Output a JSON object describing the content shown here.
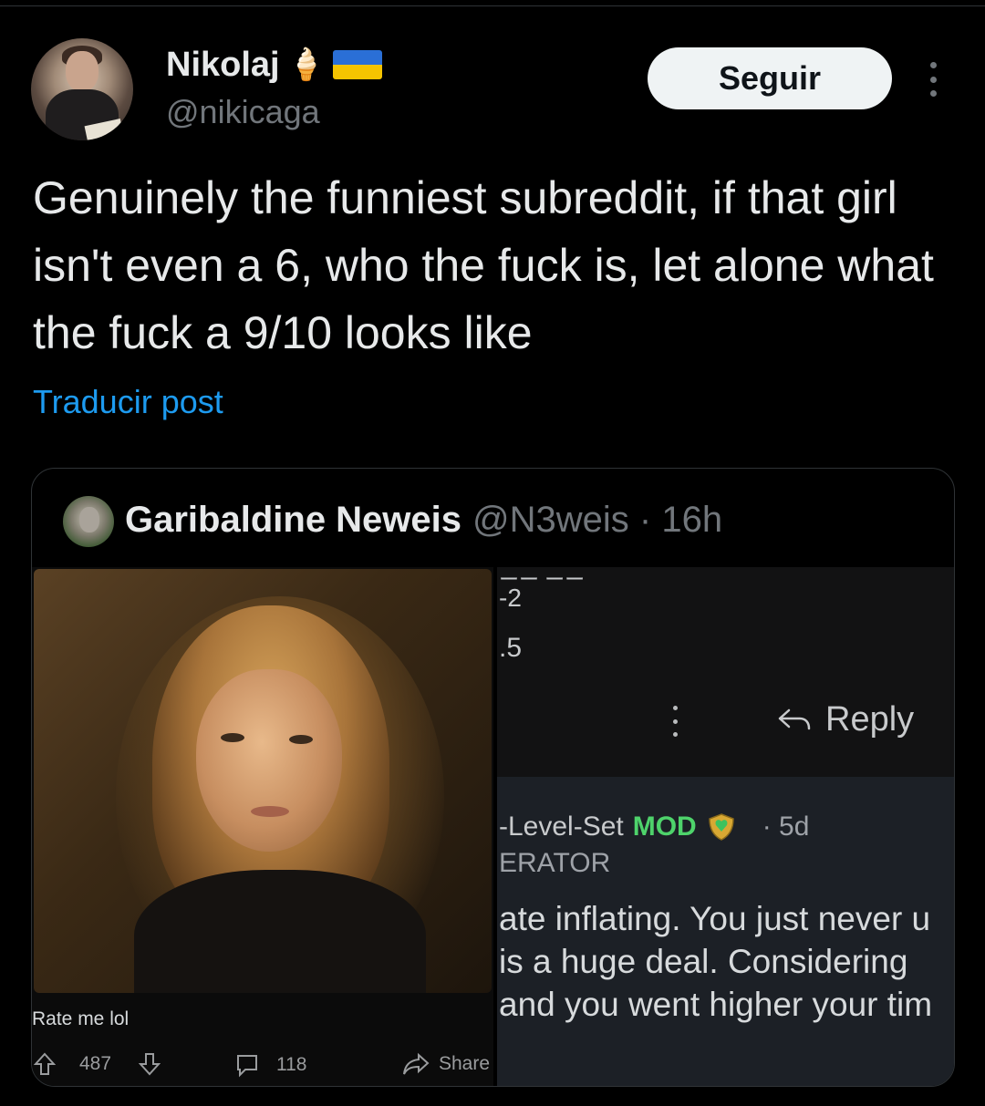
{
  "tweet": {
    "author_name": "Nikolaj",
    "author_handle": "@nikicaga",
    "name_emoji_1": "🍦",
    "follow_label": "Seguir",
    "text": "Genuinely the funniest subreddit, if that girl isn't even a 6, who the fuck is, let alone what the fuck a 9/10 looks like",
    "translate_label": "Traducir post"
  },
  "quote": {
    "author_name": "Garibaldine Neweis",
    "meta": "@N3weis · 16h",
    "left_screenshot": {
      "caption": "Rate me lol",
      "upvotes": "487",
      "comments": "118",
      "share_label": "Share"
    },
    "right_screenshot": {
      "fragment_1": "ーー ーー",
      "fragment_2": "-2",
      "fragment_3": ".5",
      "reply_label": "Reply",
      "comment_user": "-Level-Set",
      "mod_label": "MOD",
      "age": "· 5d",
      "flair": "ERATOR",
      "body_lines": [
        "ate inflating.  You just never u",
        "is a huge deal.  Considering",
        "and you went higher your tim"
      ]
    }
  },
  "colors": {
    "background": "#000000",
    "text_primary": "#e7e9ea",
    "text_secondary": "#71767b",
    "link_blue": "#1d9bf0",
    "mod_green": "#4ed36b",
    "flag_blue": "#2a6fd6",
    "flag_yellow": "#f5c400"
  }
}
